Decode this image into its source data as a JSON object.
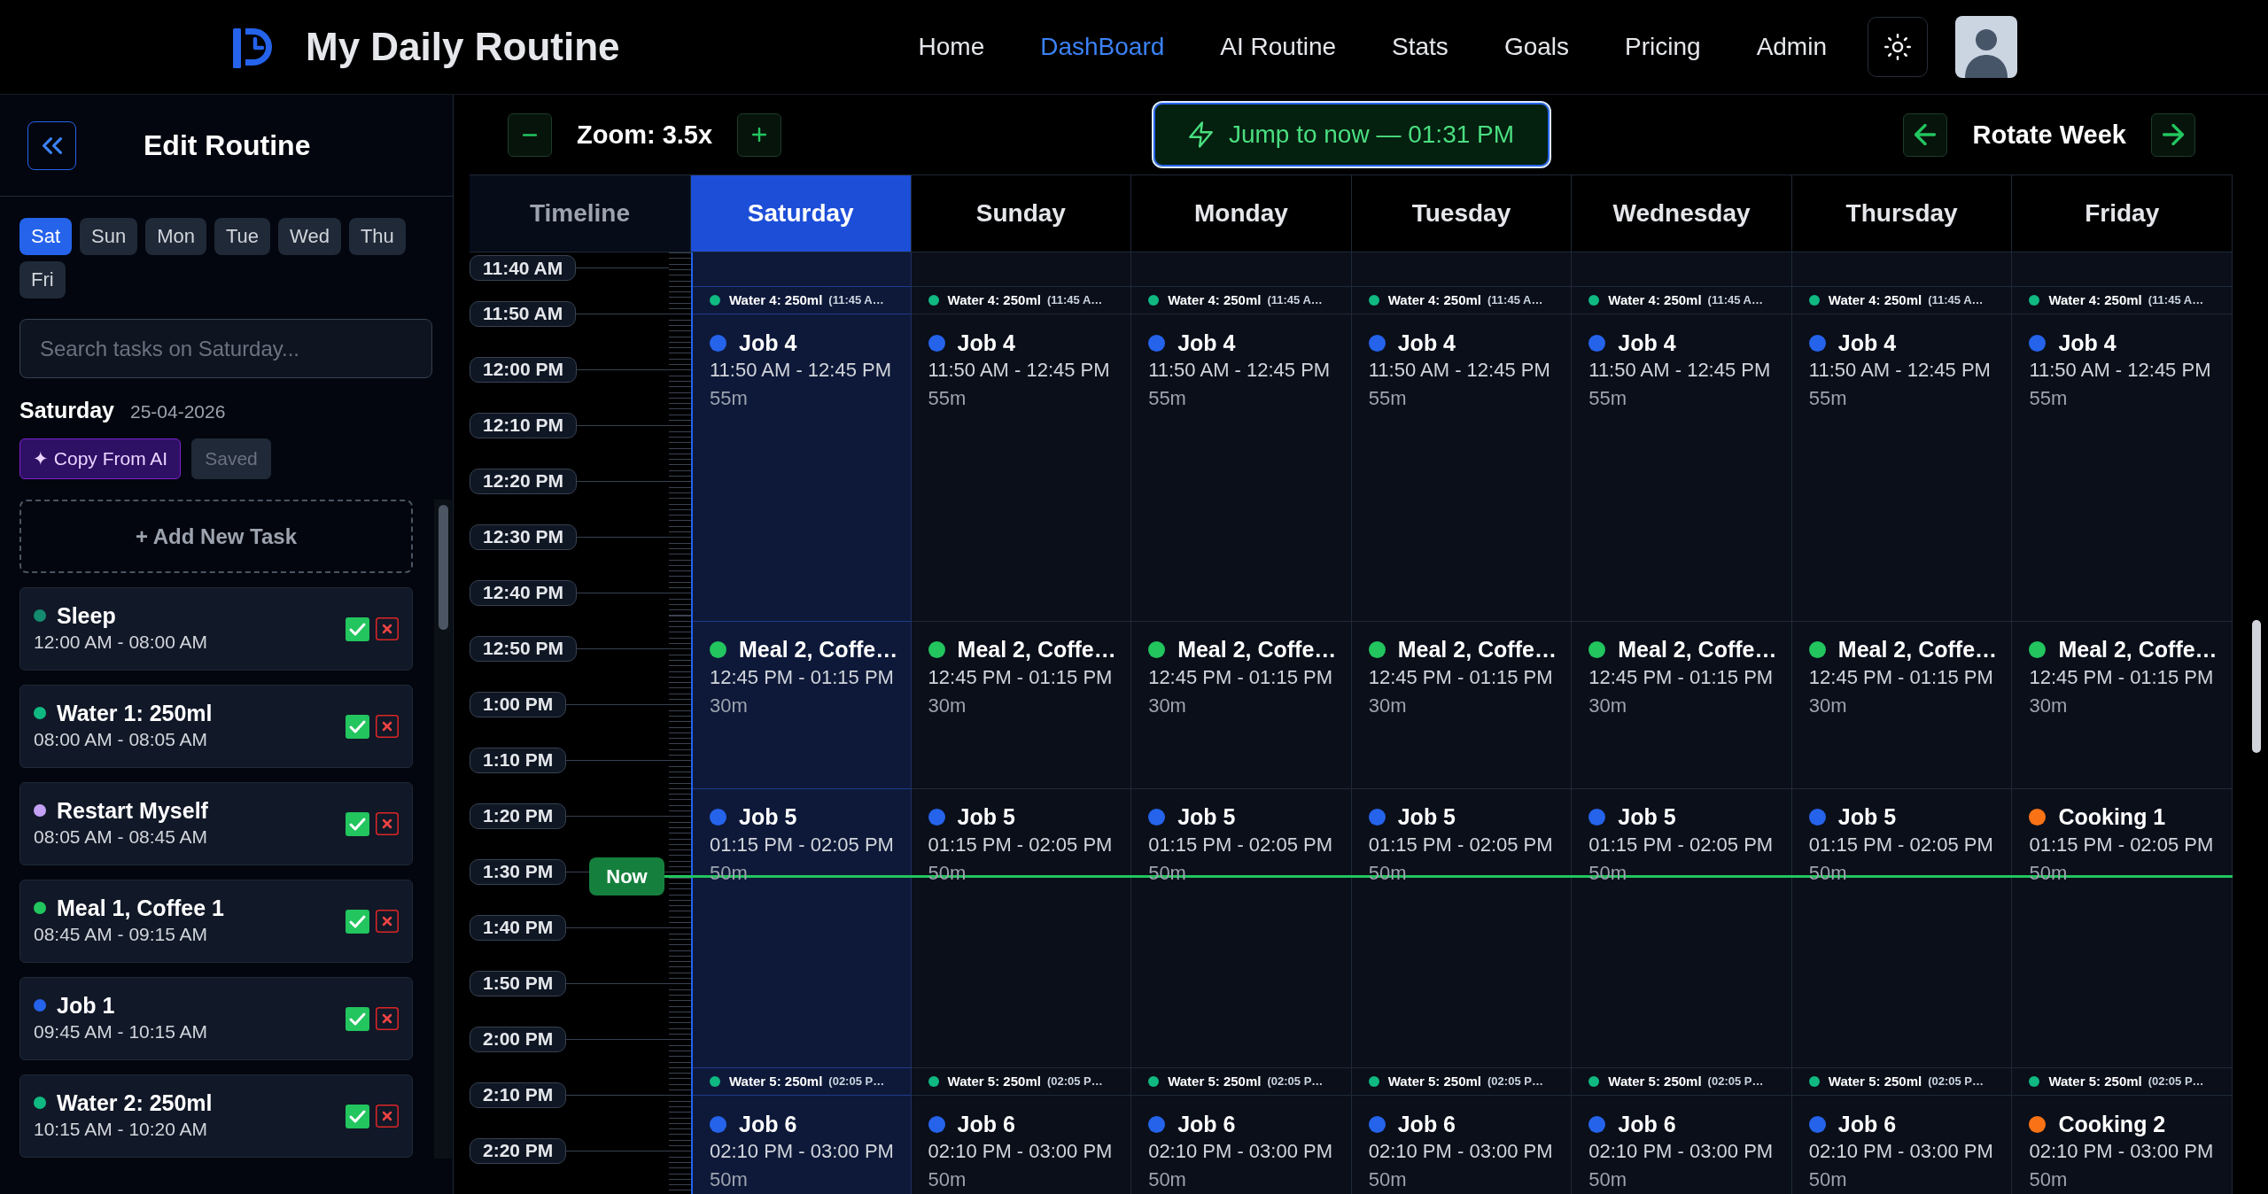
{
  "header": {
    "brand": "My Daily Routine",
    "nav": [
      {
        "label": "Home",
        "selected": false
      },
      {
        "label": "DashBoard",
        "selected": true
      },
      {
        "label": "AI Routine",
        "selected": false
      },
      {
        "label": "Stats",
        "selected": false
      },
      {
        "label": "Goals",
        "selected": false
      },
      {
        "label": "Pricing",
        "selected": false
      },
      {
        "label": "Admin",
        "selected": false
      }
    ]
  },
  "sidebar": {
    "title": "Edit Routine",
    "days": [
      {
        "label": "Sat",
        "selected": true
      },
      {
        "label": "Sun",
        "selected": false
      },
      {
        "label": "Mon",
        "selected": false
      },
      {
        "label": "Tue",
        "selected": false
      },
      {
        "label": "Wed",
        "selected": false
      },
      {
        "label": "Thu",
        "selected": false
      },
      {
        "label": "Fri",
        "selected": false
      }
    ],
    "search": {
      "placeholder": "Search tasks on Saturday..."
    },
    "day_name": "Saturday",
    "date": "25-04-2026",
    "actions": [
      {
        "kind": "ai",
        "label": "✦ Copy From AI",
        "disabled": false
      },
      {
        "kind": "save",
        "label": "Saved",
        "disabled": true
      }
    ],
    "add_task": "+ Add New Task",
    "tasks": [
      {
        "title": "Sleep",
        "time": "12:00 AM - 08:00 AM",
        "color": "#148a6e"
      },
      {
        "title": "Water 1: 250ml",
        "time": "08:00 AM - 08:05 AM",
        "color": "#10b981"
      },
      {
        "title": "Restart Myself",
        "time": "08:05 AM - 08:45 AM",
        "color": "#c4a1f5"
      },
      {
        "title": "Meal 1, Coffee 1",
        "time": "08:45 AM - 09:15 AM",
        "color": "#22c55e"
      },
      {
        "title": "Job 1",
        "time": "09:45 AM - 10:15 AM",
        "color": "#2563eb"
      },
      {
        "title": "Water 2: 250ml",
        "time": "10:15 AM - 10:20 AM",
        "color": "#10b981"
      }
    ]
  },
  "toolbar": {
    "zoom": "Zoom: 3.5x",
    "jump": "Jump to now — 01:31 PM",
    "rotate": "Rotate Week"
  },
  "calendar": {
    "timeline_heading": "Timeline",
    "times": [
      "11:40 AM",
      "11:50 AM",
      "12:00 PM",
      "12:10 PM",
      "12:20 PM",
      "12:30 PM",
      "12:40 PM",
      "12:50 PM",
      "1:00 PM",
      "1:10 PM",
      "1:20 PM",
      "1:30 PM",
      "1:40 PM",
      "1:50 PM",
      "2:00 PM",
      "2:10 PM",
      "2:20 PM"
    ],
    "now_label": "Now",
    "days": [
      {
        "label": "Saturday",
        "selected": true,
        "events": [
          {
            "kind": "water",
            "title": "Water 4: 250ml",
            "time": "(11:45 A…",
            "color": "#10b981"
          },
          {
            "kind": "block",
            "title": "Job 4",
            "time": "11:50 AM - 12:45 PM",
            "duration": "55m",
            "color": "#2563eb"
          },
          {
            "kind": "block",
            "title": "Meal 2, Coffe…",
            "time": "12:45 PM - 01:15 PM",
            "duration": "30m",
            "color": "#22c55e"
          },
          {
            "kind": "block",
            "title": "Job 5",
            "time": "01:15 PM - 02:05 PM",
            "duration": "50m",
            "color": "#2563eb"
          },
          {
            "kind": "water",
            "title": "Water 5: 250ml",
            "time": "(02:05 P…",
            "color": "#10b981"
          },
          {
            "kind": "block",
            "title": "Job 6",
            "time": "02:10 PM - 03:00 PM",
            "duration": "50m",
            "color": "#2563eb"
          }
        ]
      },
      {
        "label": "Sunday",
        "selected": false,
        "events": [
          {
            "kind": "water",
            "title": "Water 4: 250ml",
            "time": "(11:45 A…",
            "color": "#10b981"
          },
          {
            "kind": "block",
            "title": "Job 4",
            "time": "11:50 AM - 12:45 PM",
            "duration": "55m",
            "color": "#2563eb"
          },
          {
            "kind": "block",
            "title": "Meal 2, Coffe…",
            "time": "12:45 PM - 01:15 PM",
            "duration": "30m",
            "color": "#22c55e"
          },
          {
            "kind": "block",
            "title": "Job 5",
            "time": "01:15 PM - 02:05 PM",
            "duration": "50m",
            "color": "#2563eb"
          },
          {
            "kind": "water",
            "title": "Water 5: 250ml",
            "time": "(02:05 P…",
            "color": "#10b981"
          },
          {
            "kind": "block",
            "title": "Job 6",
            "time": "02:10 PM - 03:00 PM",
            "duration": "50m",
            "color": "#2563eb"
          }
        ]
      },
      {
        "label": "Monday",
        "selected": false,
        "events": [
          {
            "kind": "water",
            "title": "Water 4: 250ml",
            "time": "(11:45 A…",
            "color": "#10b981"
          },
          {
            "kind": "block",
            "title": "Job 4",
            "time": "11:50 AM - 12:45 PM",
            "duration": "55m",
            "color": "#2563eb"
          },
          {
            "kind": "block",
            "title": "Meal 2, Coffe…",
            "time": "12:45 PM - 01:15 PM",
            "duration": "30m",
            "color": "#22c55e"
          },
          {
            "kind": "block",
            "title": "Job 5",
            "time": "01:15 PM - 02:05 PM",
            "duration": "50m",
            "color": "#2563eb"
          },
          {
            "kind": "water",
            "title": "Water 5: 250ml",
            "time": "(02:05 P…",
            "color": "#10b981"
          },
          {
            "kind": "block",
            "title": "Job 6",
            "time": "02:10 PM - 03:00 PM",
            "duration": "50m",
            "color": "#2563eb"
          }
        ]
      },
      {
        "label": "Tuesday",
        "selected": false,
        "events": [
          {
            "kind": "water",
            "title": "Water 4: 250ml",
            "time": "(11:45 A…",
            "color": "#10b981"
          },
          {
            "kind": "block",
            "title": "Job 4",
            "time": "11:50 AM - 12:45 PM",
            "duration": "55m",
            "color": "#2563eb"
          },
          {
            "kind": "block",
            "title": "Meal 2, Coffe…",
            "time": "12:45 PM - 01:15 PM",
            "duration": "30m",
            "color": "#22c55e"
          },
          {
            "kind": "block",
            "title": "Job 5",
            "time": "01:15 PM - 02:05 PM",
            "duration": "50m",
            "color": "#2563eb"
          },
          {
            "kind": "water",
            "title": "Water 5: 250ml",
            "time": "(02:05 P…",
            "color": "#10b981"
          },
          {
            "kind": "block",
            "title": "Job 6",
            "time": "02:10 PM - 03:00 PM",
            "duration": "50m",
            "color": "#2563eb"
          }
        ]
      },
      {
        "label": "Wednesday",
        "selected": false,
        "events": [
          {
            "kind": "water",
            "title": "Water 4: 250ml",
            "time": "(11:45 A…",
            "color": "#10b981"
          },
          {
            "kind": "block",
            "title": "Job 4",
            "time": "11:50 AM - 12:45 PM",
            "duration": "55m",
            "color": "#2563eb"
          },
          {
            "kind": "block",
            "title": "Meal 2, Coffe…",
            "time": "12:45 PM - 01:15 PM",
            "duration": "30m",
            "color": "#22c55e"
          },
          {
            "kind": "block",
            "title": "Job 5",
            "time": "01:15 PM - 02:05 PM",
            "duration": "50m",
            "color": "#2563eb"
          },
          {
            "kind": "water",
            "title": "Water 5: 250ml",
            "time": "(02:05 P…",
            "color": "#10b981"
          },
          {
            "kind": "block",
            "title": "Job 6",
            "time": "02:10 PM - 03:00 PM",
            "duration": "50m",
            "color": "#2563eb"
          }
        ]
      },
      {
        "label": "Thursday",
        "selected": false,
        "events": [
          {
            "kind": "water",
            "title": "Water 4: 250ml",
            "time": "(11:45 A…",
            "color": "#10b981"
          },
          {
            "kind": "block",
            "title": "Job 4",
            "time": "11:50 AM - 12:45 PM",
            "duration": "55m",
            "color": "#2563eb"
          },
          {
            "kind": "block",
            "title": "Meal 2, Coffe…",
            "time": "12:45 PM - 01:15 PM",
            "duration": "30m",
            "color": "#22c55e"
          },
          {
            "kind": "block",
            "title": "Job 5",
            "time": "01:15 PM - 02:05 PM",
            "duration": "50m",
            "color": "#2563eb"
          },
          {
            "kind": "water",
            "title": "Water 5: 250ml",
            "time": "(02:05 P…",
            "color": "#10b981"
          },
          {
            "kind": "block",
            "title": "Job 6",
            "time": "02:10 PM - 03:00 PM",
            "duration": "50m",
            "color": "#2563eb"
          }
        ]
      },
      {
        "label": "Friday",
        "selected": false,
        "events": [
          {
            "kind": "water",
            "title": "Water 4: 250ml",
            "time": "(11:45 A…",
            "color": "#10b981"
          },
          {
            "kind": "block",
            "title": "Job 4",
            "time": "11:50 AM - 12:45 PM",
            "duration": "55m",
            "color": "#2563eb"
          },
          {
            "kind": "block",
            "title": "Meal 2, Coffe…",
            "time": "12:45 PM - 01:15 PM",
            "duration": "30m",
            "color": "#22c55e"
          },
          {
            "kind": "block",
            "title": "Cooking 1",
            "time": "01:15 PM - 02:05 PM",
            "duration": "50m",
            "color": "#f97316"
          },
          {
            "kind": "water",
            "title": "Water 5: 250ml",
            "time": "(02:05 P…",
            "color": "#10b981"
          },
          {
            "kind": "block",
            "title": "Cooking 2",
            "time": "02:10 PM - 03:00 PM",
            "duration": "50m",
            "color": "#f97316"
          }
        ]
      }
    ]
  }
}
